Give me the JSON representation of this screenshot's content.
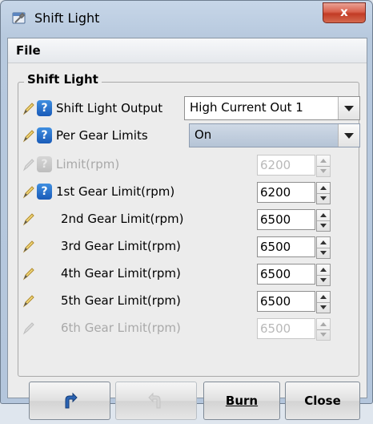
{
  "window": {
    "title": "Shift Light",
    "close_symbol": "x",
    "app_icon": "wrench-window-icon",
    "close_color": "#c8432d"
  },
  "menu": {
    "file_label": "File"
  },
  "group": {
    "title": "Shift Light"
  },
  "fields": {
    "shift_light_output": {
      "label": "Shift Light Output",
      "value": "High Current Out 1"
    },
    "per_gear_limits": {
      "label": "Per Gear Limits",
      "value": "On"
    },
    "limit": {
      "label": "Limit(rpm)",
      "value": "6200"
    },
    "gear1": {
      "label": "1st Gear Limit(rpm)",
      "value": "6200"
    },
    "gear2": {
      "label": "2nd Gear Limit(rpm)",
      "value": "6500"
    },
    "gear3": {
      "label": "3rd Gear Limit(rpm)",
      "value": "6500"
    },
    "gear4": {
      "label": "4th Gear Limit(rpm)",
      "value": "6500"
    },
    "gear5": {
      "label": "5th Gear Limit(rpm)",
      "value": "6500"
    },
    "gear6": {
      "label": "6th Gear Limit(rpm)",
      "value": "6500"
    }
  },
  "help_symbol": "?",
  "buttons": {
    "undo_icon": "undo-arrow-icon",
    "redo_icon": "redo-arrow-icon",
    "burn_label": "Burn",
    "close_label": "Close"
  }
}
